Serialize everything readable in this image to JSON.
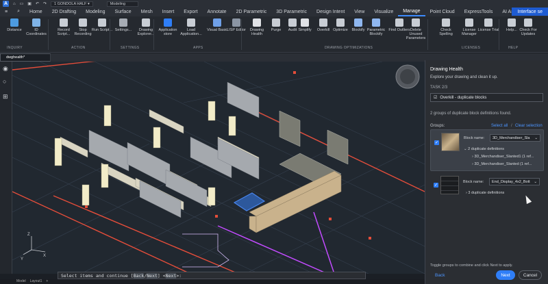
{
  "qat": {
    "layer": "1 GONDOLA HALF",
    "workspace": "Modeling"
  },
  "menu": {
    "items": [
      "Home",
      "2D Drafting",
      "Modeling",
      "Surface",
      "Mesh",
      "Insert",
      "Export",
      "Annotate",
      "2D Parametric",
      "3D Parametric",
      "Design Intent",
      "View",
      "Visualize",
      "Manage",
      "Point Cloud",
      "ExpressTools",
      "AI Assist"
    ],
    "active": "Manage",
    "interface": "Interface se"
  },
  "ribbon": {
    "buttons": [
      "Distance",
      "ID Coordinates",
      "Record Script...",
      "Stop Recording",
      "Run Script...",
      "Settings...",
      "Drawing Explorer...",
      "Application store",
      "Load Application...",
      "Visual Basic",
      "LISP Editor",
      "Drawing Health",
      "Purge",
      "Audit",
      "Simplify",
      "Overkill",
      "Optimize",
      "Blockify",
      "Parametric Blockify",
      "Find Outliers",
      "Delete Unused Parameters",
      "Check Spelling",
      "License Manager",
      "License Trial",
      "Help...",
      "Check For Updates"
    ],
    "groups": [
      "INQUIRY",
      "ACTION",
      "SETTINGS",
      "APPS",
      "DRAWING OPTIMIZATIONS",
      "LICENSES",
      "HELP"
    ]
  },
  "tabs": [
    "Start",
    "dwghealth*",
    "+"
  ],
  "panel": {
    "title": "Drawing Health",
    "subtitle": "Explore your drawing and clean it up.",
    "task": "TASK 2/3",
    "task_name": "Overkill - duplicate blocks",
    "found": "2 groups of duplicate block definitions found.",
    "groups_label": "Groups:",
    "select_all": "Select all",
    "sep": "/",
    "clear_selection": "Clear selection",
    "block_label": "Block name:",
    "group1": {
      "block": "3D_Merchandiser_Sla",
      "dups": "2 duplicate definitions",
      "items": [
        "3D_Merchandiser_Slanted1 (1 ref...",
        "3D_Merchandiser_Slanted (1 ref..."
      ]
    },
    "group2": {
      "block": "End_Display_4x2_Bott",
      "dups": "3 duplicate definitions"
    },
    "hint": "Toggle groups to combine and click Next to apply.",
    "back": "Back",
    "next": "Next",
    "cancel": "Cancel"
  },
  "cmdline": {
    "prefix": "Select items and continue [",
    "back": "Back",
    "slash": "/",
    "next": "Next",
    "mid": "] <",
    "def": "Next",
    "end": ">:"
  },
  "status": {
    "tabs": [
      "Model",
      "Layout1",
      "+"
    ]
  }
}
